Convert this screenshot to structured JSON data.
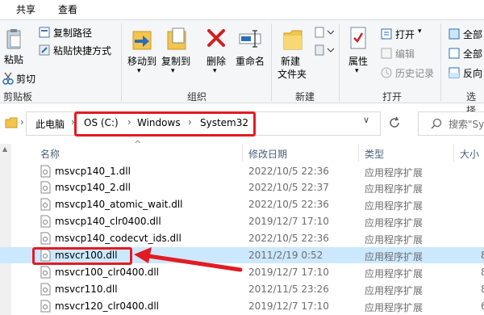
{
  "tabs": [
    "共享",
    "查看"
  ],
  "clipboard": {
    "paste": "粘贴",
    "copy_path": "复制路径",
    "paste_shortcut": "粘贴快捷方式",
    "cut": "剪切",
    "group": "剪贴板"
  },
  "organize": {
    "move_to": "移动到",
    "copy_to": "复制到",
    "delete": "删除",
    "rename": "重命名",
    "group": "组织"
  },
  "new": {
    "new_folder_l1": "新建",
    "new_folder_l2": "文件夹",
    "group": "新建"
  },
  "open": {
    "properties": "属性",
    "open": "打开",
    "edit": "编辑",
    "history": "历史记录",
    "group": "打开"
  },
  "select": {
    "all1": "全部",
    "all2": "全部",
    "invert": "反向",
    "group": "选择"
  },
  "address": {
    "root": "此电脑",
    "crumbs": [
      "OS (C:)",
      "Windows",
      "System32"
    ],
    "search_placeholder": "搜索\"Sy"
  },
  "columns": {
    "name": "名称",
    "date": "修改日期",
    "type": "类型",
    "size": "大小"
  },
  "files": [
    {
      "name": "msvcp140_1.dll",
      "date": "2022/10/5 22:36",
      "type": "应用程序扩展",
      "size": ""
    },
    {
      "name": "msvcp140_2.dll",
      "date": "2022/10/5 22:37",
      "type": "应用程序扩展",
      "size": ""
    },
    {
      "name": "msvcp140_atomic_wait.dll",
      "date": "2022/10/5 22:36",
      "type": "应用程序扩展",
      "size": ""
    },
    {
      "name": "msvcp140_clr0400.dll",
      "date": "2019/12/7 17:10",
      "type": "应用程序扩展",
      "size": ""
    },
    {
      "name": "msvcp140_codecvt_ids.dll",
      "date": "2022/10/5 22:36",
      "type": "应用程序扩展",
      "size": ""
    },
    {
      "name": "msvcr100.dll",
      "date": "2011/2/19 0:52",
      "type": "应用程序扩展",
      "size": "8"
    },
    {
      "name": "msvcr100_clr0400.dll",
      "date": "2019/12/7 17:10",
      "type": "应用程序扩展",
      "size": "8"
    },
    {
      "name": "msvcr110.dll",
      "date": "2012/11/5 23:26",
      "type": "应用程序扩展",
      "size": "8"
    },
    {
      "name": "msvcr120_clr0400.dll",
      "date": "2019/12/7 17:10",
      "type": "应用程序扩展",
      "size": "6"
    }
  ],
  "colors": {
    "accent": "#e31b23",
    "selection": "#cce8ff"
  }
}
